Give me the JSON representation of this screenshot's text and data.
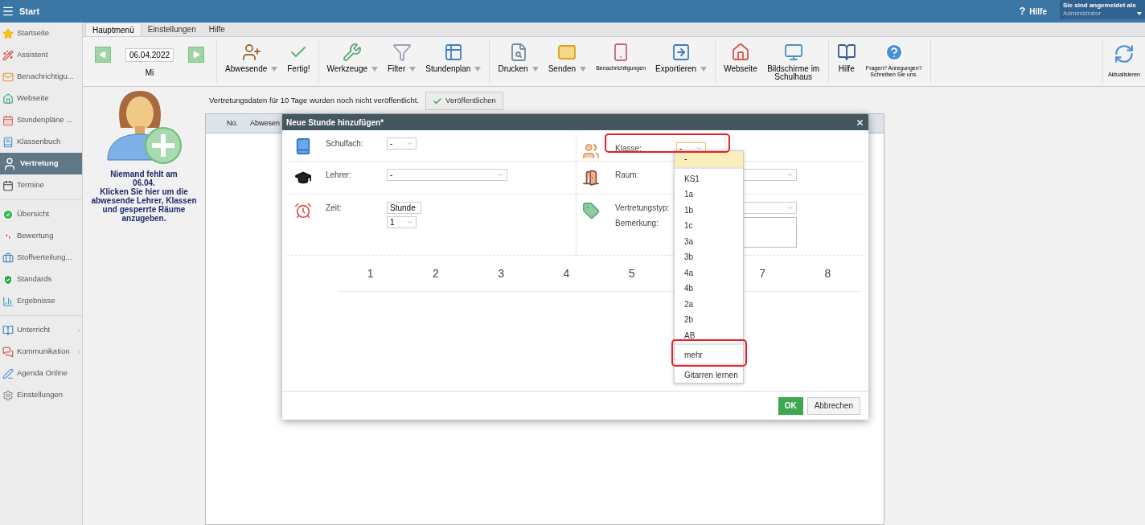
{
  "topbar": {
    "title": "Start",
    "help_icon": "?",
    "help": "Hilfe",
    "login_label": "Sie sind angemeldet als",
    "user": "Administrator"
  },
  "sidebar": {
    "sections": [
      [
        {
          "label": "Startseite",
          "selected": false,
          "expandable": false
        },
        {
          "label": "Assistent",
          "selected": false,
          "expandable": false
        },
        {
          "label": "Benachrichtigu...",
          "selected": false,
          "expandable": false
        },
        {
          "label": "Webseite",
          "selected": false,
          "expandable": false
        },
        {
          "label": "Stundenpläne ...",
          "selected": false,
          "expandable": false
        },
        {
          "label": "Klassenbuch",
          "selected": false,
          "expandable": false
        },
        {
          "label": "Vertretung",
          "selected": true,
          "expandable": false
        },
        {
          "label": "Termine",
          "selected": false,
          "expandable": false
        }
      ],
      [
        {
          "label": "Übersicht",
          "selected": false,
          "expandable": false
        },
        {
          "label": "Bewertung",
          "selected": false,
          "expandable": false
        },
        {
          "label": "Stoffverteilung...",
          "selected": false,
          "expandable": false
        },
        {
          "label": "Standards",
          "selected": false,
          "expandable": false
        },
        {
          "label": "Ergebnisse",
          "selected": false,
          "expandable": false
        }
      ],
      [
        {
          "label": "Unterricht",
          "selected": false,
          "expandable": true
        },
        {
          "label": "Kommunikation",
          "selected": false,
          "expandable": true
        },
        {
          "label": "Agenda Online",
          "selected": false,
          "expandable": false
        },
        {
          "label": "Einstellungen",
          "selected": false,
          "expandable": false
        }
      ]
    ]
  },
  "tabs": [
    {
      "label": "Hauptmenü",
      "selected": true
    },
    {
      "label": "Einstellungen",
      "selected": false
    },
    {
      "label": "Hilfe",
      "selected": false
    }
  ],
  "ribbon": {
    "date": "06.04.2022",
    "weekday": "Mi",
    "groups": [
      [
        {
          "label": "Abwesende",
          "dropdown": true
        },
        {
          "label": "Fertig!",
          "dropdown": false
        }
      ],
      [
        {
          "label": "Werkzeuge",
          "dropdown": true
        },
        {
          "label": "Filter",
          "dropdown": true
        },
        {
          "label": "Stundenplan",
          "dropdown": true
        }
      ],
      [
        {
          "label": "Drucken",
          "dropdown": true
        },
        {
          "label": "Senden",
          "dropdown": true
        },
        {
          "label": "Benachrichtigungen",
          "dropdown": false,
          "small": true
        },
        {
          "label": "Exportieren",
          "dropdown": true
        }
      ],
      [
        {
          "label": "Webseite",
          "dropdown": false
        },
        {
          "label": "Bildschirme im Schulhaus",
          "dropdown": false
        }
      ],
      [
        {
          "label": "Hilfe",
          "dropdown": false
        },
        {
          "label": "Fragen? Anregungen? Schreiben Sie uns.",
          "dropdown": false,
          "small": true
        }
      ]
    ],
    "refresh": "Aktualisieren"
  },
  "absence": {
    "text": "Niemand fehlt am\n06.04.\nKlicken Sie hier um die\nabwesende Lehrer, Klassen\nund gesperrte Räume\nanzugeben."
  },
  "notice": {
    "text": "Vertretungsdaten für 10 Tage wurden noch nicht veröffentlicht.",
    "button": "Veröffentlichen"
  },
  "table": {
    "columns": [
      "No.",
      "Abwesen"
    ]
  },
  "dialog": {
    "title": "Neue Stunde hinzufügen*",
    "left_rows": [
      {
        "fields": [
          {
            "label": "Schulfach:",
            "kind": "select",
            "values": [
              "-"
            ]
          }
        ]
      },
      {
        "fields": [
          {
            "label": "Lehrer:",
            "kind": "wide_select",
            "values": [
              "-"
            ]
          }
        ]
      },
      {
        "fields": [
          {
            "label": "Zeit:",
            "kind": "select",
            "values": [
              "Stunde",
              "1"
            ]
          }
        ]
      }
    ],
    "right_rows": [
      {
        "fields": [
          {
            "label": "Klasse:",
            "kind": "select",
            "values": [
              "-"
            ],
            "focused": true
          }
        ]
      },
      {
        "fields": [
          {
            "label": "Raum:",
            "kind": "wide_select",
            "focused": false
          }
        ]
      },
      {
        "fields": [
          {
            "label": "Vertretungstyp:",
            "kind": "wide_select",
            "focused": false
          },
          {
            "label": "Bemerkung:",
            "kind": "textarea"
          }
        ]
      }
    ],
    "periods_before": [
      "1",
      "2",
      "3",
      "4",
      "5"
    ],
    "periods_after": [
      "7",
      "8"
    ],
    "ok": "OK",
    "cancel": "Abbrechen"
  },
  "dropdown": {
    "option_groups": [
      [
        {
          "label": "-",
          "selected": true
        }
      ],
      [
        {
          "label": "KS1",
          "selected": false
        },
        {
          "label": "1a",
          "selected": false
        },
        {
          "label": "1b",
          "selected": false
        },
        {
          "label": "1c",
          "selected": false
        },
        {
          "label": "3a",
          "selected": false
        },
        {
          "label": "3b",
          "selected": false
        },
        {
          "label": "4a",
          "selected": false
        },
        {
          "label": "4b",
          "selected": false
        },
        {
          "label": "2a",
          "selected": false
        },
        {
          "label": "2b",
          "selected": false
        },
        {
          "label": "AB",
          "selected": false
        }
      ],
      [
        {
          "label": "mehr",
          "selected": false
        }
      ],
      [
        {
          "label": "Gitarren lernen",
          "selected": false
        }
      ]
    ]
  }
}
